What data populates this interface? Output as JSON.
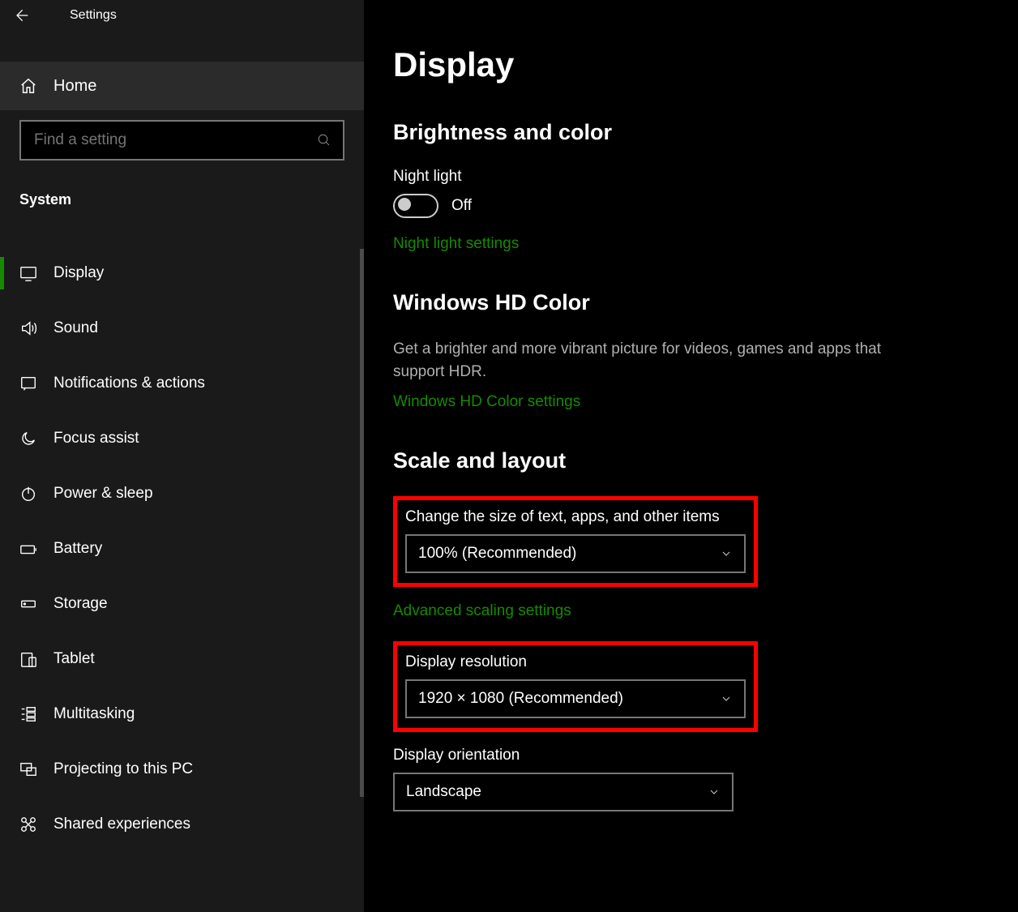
{
  "app_title": "Settings",
  "home_label": "Home",
  "search_placeholder": "Find a setting",
  "category_label": "System",
  "nav": [
    {
      "id": "display",
      "label": "Display",
      "active": true
    },
    {
      "id": "sound",
      "label": "Sound"
    },
    {
      "id": "notifications",
      "label": "Notifications & actions"
    },
    {
      "id": "focus",
      "label": "Focus assist"
    },
    {
      "id": "power",
      "label": "Power & sleep"
    },
    {
      "id": "battery",
      "label": "Battery"
    },
    {
      "id": "storage",
      "label": "Storage"
    },
    {
      "id": "tablet",
      "label": "Tablet"
    },
    {
      "id": "multitasking",
      "label": "Multitasking"
    },
    {
      "id": "projecting",
      "label": "Projecting to this PC"
    },
    {
      "id": "shared",
      "label": "Shared experiences"
    }
  ],
  "page": {
    "title": "Display",
    "sections": {
      "brightness": {
        "title": "Brightness and color",
        "night_light_label": "Night light",
        "night_light_state": "Off",
        "night_light_link": "Night light settings"
      },
      "hdcolor": {
        "title": "Windows HD Color",
        "desc": "Get a brighter and more vibrant picture for videos, games and apps that support HDR.",
        "link": "Windows HD Color settings"
      },
      "scale": {
        "title": "Scale and layout",
        "scale_label": "Change the size of text, apps, and other items",
        "scale_value": "100% (Recommended)",
        "adv_link": "Advanced scaling settings",
        "res_label": "Display resolution",
        "res_value": "1920 × 1080 (Recommended)",
        "orient_label": "Display orientation",
        "orient_value": "Landscape"
      }
    }
  }
}
